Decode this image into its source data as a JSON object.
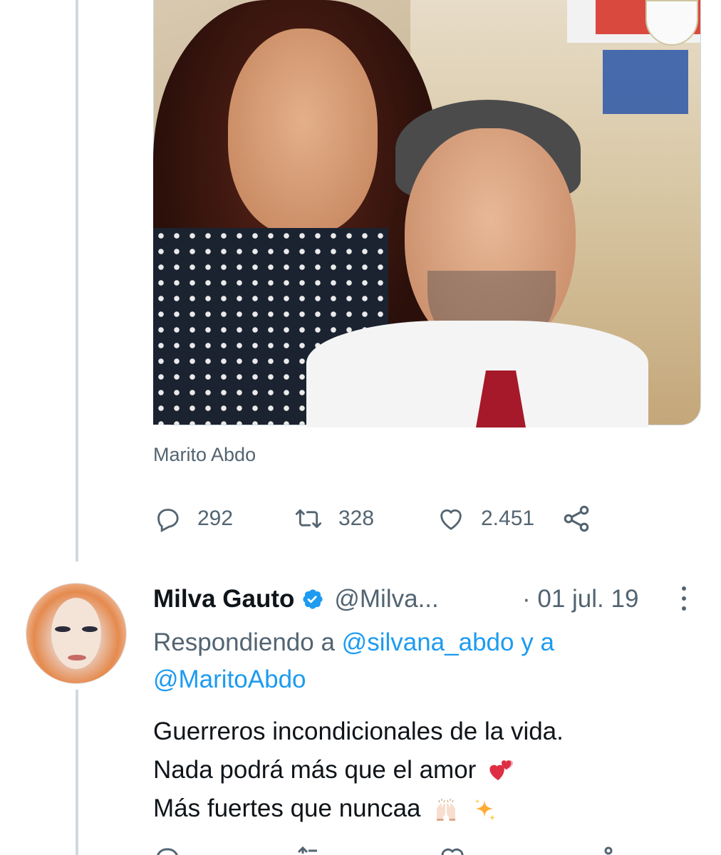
{
  "media": {
    "source_label": "Marito Abdo"
  },
  "actions": {
    "replies": "292",
    "retweets": "328",
    "likes": "2.451"
  },
  "reply": {
    "name": "Milva Gauto",
    "handle": "@Milva...",
    "date": "· 01 jul. 19",
    "replying_prefix": "Respondiendo a",
    "replying_user1": "@silvana_abdo",
    "replying_and": "y a",
    "replying_user2": "@MaritoAbdo",
    "line1": "Guerreros incondicionales de la vida.",
    "line2": "Nada podrá más que el amor",
    "line3": "Más fuertes que nuncaa",
    "icons": [
      "reply-icon",
      "retweet-icon",
      "like-icon",
      "share-icon",
      "verified-badge-icon",
      "more-icon",
      "two-hearts-emoji",
      "raising-hands-emoji",
      "sparkles-emoji"
    ]
  },
  "colors": {
    "text": "#0f1419",
    "secondary": "#536471",
    "link": "#1d9bf0",
    "thread_line": "#cfd9de"
  }
}
